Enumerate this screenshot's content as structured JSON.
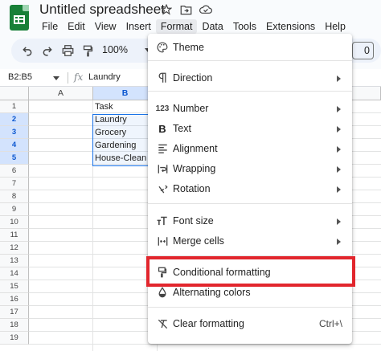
{
  "app": {
    "doc_title": "Untitled spreadsheet",
    "menus": [
      "File",
      "Edit",
      "View",
      "Insert",
      "Format",
      "Data",
      "Tools",
      "Extensions",
      "Help"
    ],
    "active_menu": "Format"
  },
  "toolbar": {
    "zoom": "100%",
    "right_box_value": "0"
  },
  "formula_bar": {
    "name_box": "B2:B5",
    "fx_label": "fx",
    "content": "Laundry"
  },
  "sheet": {
    "columns": [
      "A",
      "B"
    ],
    "selected_column": "B",
    "rows": [
      "1",
      "2",
      "3",
      "4",
      "5",
      "6",
      "7",
      "8",
      "9",
      "10",
      "11",
      "12",
      "13",
      "14",
      "15",
      "16",
      "17",
      "18",
      "19"
    ],
    "selected_rows": [
      "2",
      "3",
      "4",
      "5"
    ],
    "cells": {
      "B1": "Task",
      "B2": "Laundry",
      "B3": "Grocery",
      "B4": "Gardening",
      "B5": "House-Clean u"
    }
  },
  "format_menu": {
    "theme": "Theme",
    "direction": "Direction",
    "number": "Number",
    "text": "Text",
    "alignment": "Alignment",
    "wrapping": "Wrapping",
    "rotation": "Rotation",
    "font_size": "Font size",
    "merge_cells": "Merge cells",
    "conditional_formatting": "Conditional formatting",
    "alternating_colors": "Alternating colors",
    "clear_formatting": "Clear formatting",
    "clear_formatting_shortcut": "Ctrl+\\",
    "number_icon_text": "123",
    "text_icon_text": "B"
  },
  "colors": {
    "highlight": "#e2262d",
    "selection": "#1a73e8",
    "sheets_green": "#188038"
  }
}
